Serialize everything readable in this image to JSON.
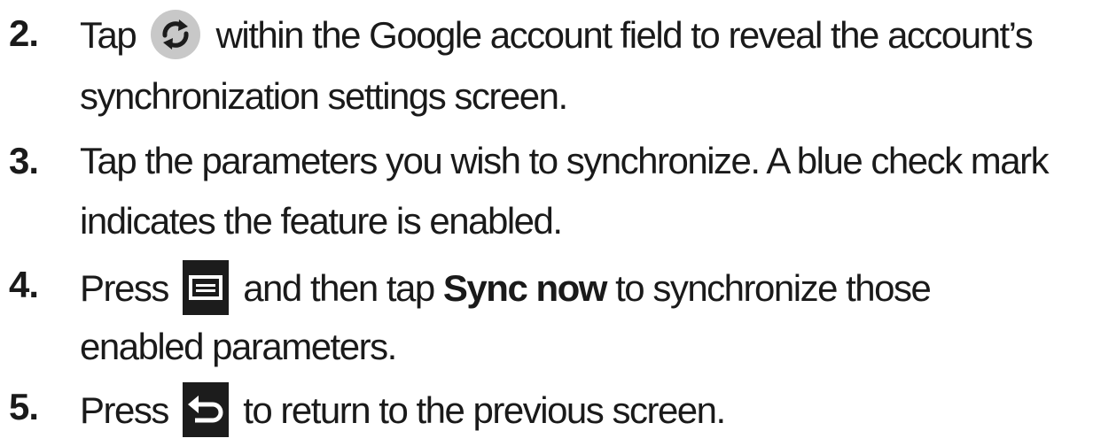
{
  "steps": [
    {
      "number": "2.",
      "line1_a": "Tap",
      "icon1": "sync-icon",
      "line1_b": "within the Google account field to reveal the account’s",
      "line2": "synchronization settings screen."
    },
    {
      "number": "3.",
      "line1": "Tap the parameters you wish to synchronize. A blue check mark",
      "line2": "indicates the feature is enabled."
    },
    {
      "number": "4.",
      "line1_a": "Press",
      "icon1": "menu-icon",
      "line1_b": "and then tap",
      "line1_bold": "Sync now",
      "line1_c": "to synchronize those",
      "line2": "enabled parameters."
    },
    {
      "number": "5.",
      "line1_a": "Press",
      "icon1": "back-icon",
      "line1_b": "to return to the previous screen."
    }
  ],
  "colors": {
    "text": "#1a1a1a",
    "icon_dark": "#1c1c1c",
    "sync_circle": "#c8c8c8"
  }
}
